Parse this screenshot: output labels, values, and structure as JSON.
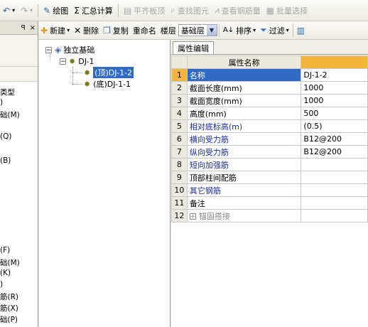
{
  "toolbar1": {
    "undo_icon": "undo-icon",
    "draw_label": "绘图",
    "sum_label": "汇总计算",
    "flat_top_label": "平齐板顶",
    "find_elem_label": "查找图元",
    "view_rebar_label": "查看钢筋量",
    "batch_select_label": "批量选择"
  },
  "left_panel": {
    "pin": "ꟼ",
    "close": "×",
    "items": [
      "类型",
      ")",
      "础(M)",
      "(Q)",
      "(B)",
      "(F)",
      "础(M)",
      "(K)",
      ")",
      "筋(R)",
      "筋(X)",
      "础(P)"
    ]
  },
  "toolbar2": {
    "new_label": "新建",
    "delete_label": "删除",
    "copy_label": "复制",
    "rename_label": "重命名",
    "floor_label": "楼层",
    "floor_value": "基础层",
    "sort_label": "排序",
    "filter_label": "过滤"
  },
  "tree": {
    "root": "独立基础",
    "child": "DJ-1",
    "leaves": [
      "(顶)DJ-1-2",
      "(底)DJ-1-1"
    ]
  },
  "prop": {
    "tab_label": "属性编辑",
    "header_name": "属性名称",
    "header_value": "",
    "rows": [
      {
        "n": "1",
        "name": "名称",
        "value": "DJ-1-2"
      },
      {
        "n": "2",
        "name": "截面长度(mm)",
        "value": "1000"
      },
      {
        "n": "3",
        "name": "截面宽度(mm)",
        "value": "1000"
      },
      {
        "n": "4",
        "name": "高度(mm)",
        "value": "500"
      },
      {
        "n": "5",
        "name": "相对底标高(m)",
        "value": "(0.5)"
      },
      {
        "n": "6",
        "name": "横向受力筋",
        "value": "B12@200"
      },
      {
        "n": "7",
        "name": "纵向受力筋",
        "value": "B12@200"
      },
      {
        "n": "8",
        "name": "短向加强筋",
        "value": ""
      },
      {
        "n": "9",
        "name": "顶部柱间配筋",
        "value": ""
      },
      {
        "n": "10",
        "name": "其它钢筋",
        "value": ""
      },
      {
        "n": "11",
        "name": "备注",
        "value": ""
      },
      {
        "n": "12",
        "name": "锚固搭接",
        "value": ""
      }
    ]
  }
}
